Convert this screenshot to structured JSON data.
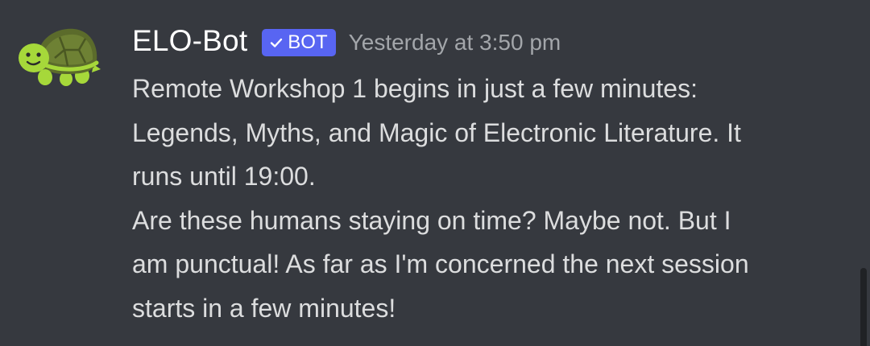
{
  "message": {
    "author": {
      "name": "ELO-Bot",
      "bot_tag": "BOT",
      "avatar_icon": "turtle-icon"
    },
    "timestamp": "Yesterday at 3:50 pm",
    "lines": [
      "Remote Workshop 1 begins in just a few minutes:",
      "Legends, Myths, and Magic of Electronic Literature. It",
      "runs until 19:00.",
      "Are these humans staying on time? Maybe not. But I",
      "am punctual! As far as I'm concerned the next session",
      "starts in a few minutes!"
    ]
  },
  "colors": {
    "background": "#36393f",
    "username": "#ffffff",
    "bot_tag_bg": "#5865f2",
    "timestamp": "#a3a6aa",
    "message_text": "#dcddde",
    "scrollbar": "#202225"
  }
}
